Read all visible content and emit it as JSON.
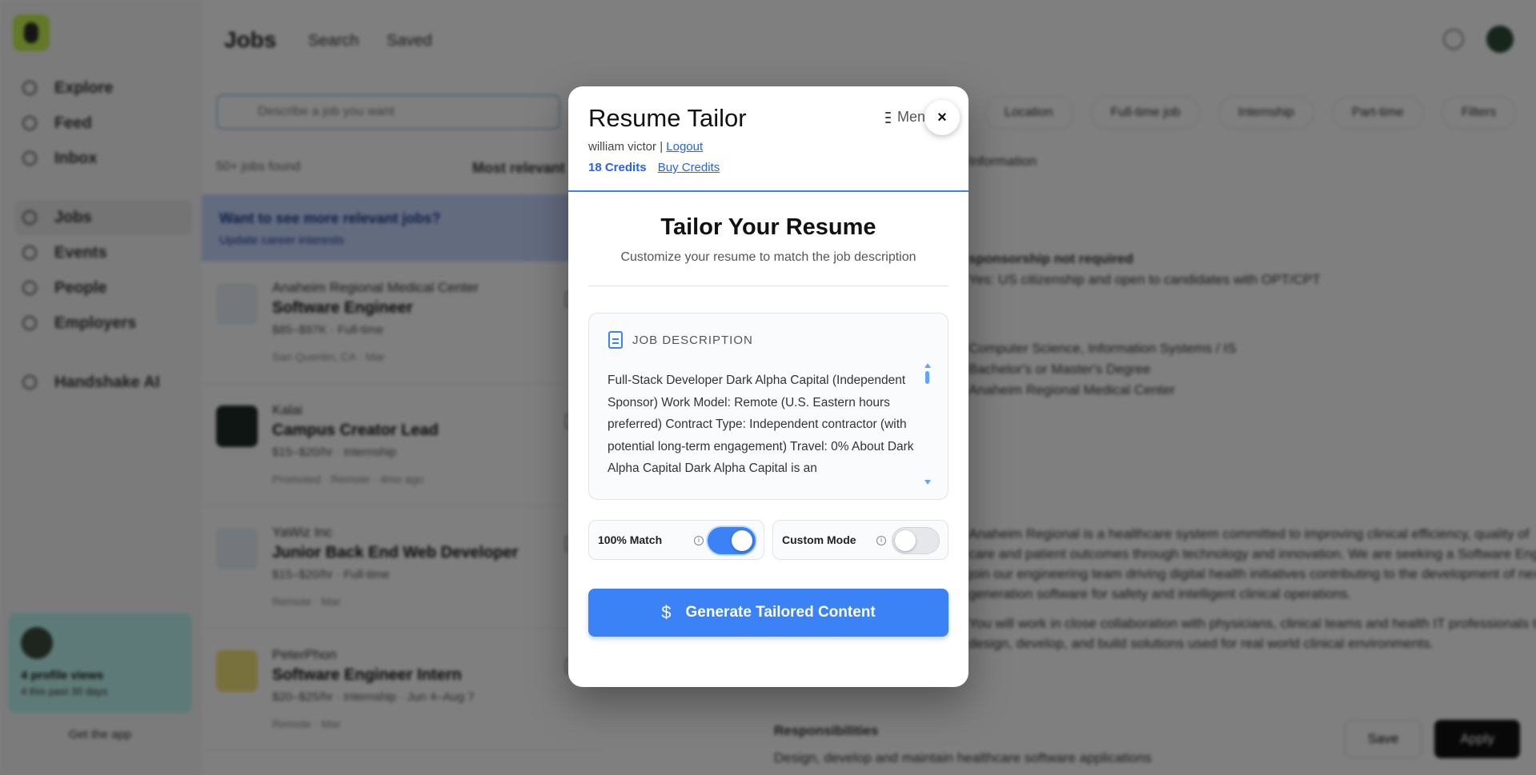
{
  "background": {
    "sidebar": {
      "items_top": [
        "Explore",
        "Feed",
        "Inbox"
      ],
      "items_mid": [
        "Jobs",
        "Events",
        "People",
        "Employers"
      ],
      "items_bottom": [
        "Handshake AI"
      ],
      "promo": {
        "line1": "4 profile views",
        "line2": "4 this past 30 days"
      },
      "get_app": "Get the app"
    },
    "topbar": {
      "title": "Jobs",
      "link1": "Search",
      "link2": "Saved"
    },
    "search_placeholder": "Describe a job you want",
    "filters": [
      "Location",
      "Full-time job",
      "Internship",
      "Part-time",
      "Filters"
    ],
    "list_count": "50+ jobs found",
    "sort": "Most relevant",
    "banner": {
      "title": "Want to see more relevant jobs?",
      "sub": "Update career interests"
    },
    "jobs": [
      {
        "company": "Anaheim Regional Medical Center",
        "title": "Software Engineer",
        "meta": "$85–$97K · Full-time",
        "sub": "San Quentin, CA · Mar"
      },
      {
        "company": "Kalai",
        "title": "Campus Creator Lead",
        "meta": "$15–$20/hr · Internship",
        "sub": "Promoted · Remote · 4mo ago"
      },
      {
        "company": "YaWiz Inc",
        "title": "Junior Back End Web Developer",
        "meta": "$15–$20/hr · Full-time",
        "sub": "Remote · Mar"
      },
      {
        "company": "PeterPhon",
        "title": "Software Engineer Intern",
        "meta": "$20–$25/hr · Internship · Jun 4–Aug 7",
        "sub": "Remote · Mar"
      }
    ],
    "detail_lines": [
      "Information",
      "sponsorship not required",
      "Yes: US citizenship and open to candidates with OPT/CPT",
      "Computer Science, Information Systems / IS",
      "Bachelor's or Master's Degree",
      "Anaheim Regional Medical Center",
      "Anaheim Regional is a healthcare system committed to improving clinical efficiency, quality of",
      "care and patient outcomes through technology and innovation. We are seeking a Software Engineer to",
      "join our engineering team driving digital health initiatives contributing to the development of next-",
      "generation software for safety and intelligent clinical operations.",
      "You will work in close collaboration with physicians, clinical teams and health IT professionals to",
      "design, develop, and build solutions used for real world clinical environments.",
      "Responsibilities",
      "Design, develop and maintain healthcare software applications"
    ],
    "save_label": "Save",
    "apply_label": "Apply"
  },
  "modal": {
    "title": "Resume Tailor",
    "user_name": "william victor",
    "separator": "|",
    "logout_label": "Logout",
    "credits": "18 Credits",
    "buy_credits_label": "Buy Credits",
    "menu_label": "Menu",
    "close_label": "×",
    "heading": "Tailor Your Resume",
    "subheading": "Customize your resume to match the job description",
    "job_description_label": "JOB DESCRIPTION",
    "job_description_text": "Full-Stack Developer Dark Alpha Capital (Independent Sponsor) Work Model: Remote (U.S. Eastern hours preferred) Contract Type: Independent contractor (with potential long-term engagement) Travel: 0% About Dark Alpha Capital Dark Alpha Capital is an",
    "toggle_match": {
      "label": "100% Match",
      "on": true
    },
    "toggle_custom": {
      "label": "Custom Mode",
      "on": false
    },
    "generate_label": "Generate Tailored Content",
    "accent_color": "#3b82f6"
  }
}
